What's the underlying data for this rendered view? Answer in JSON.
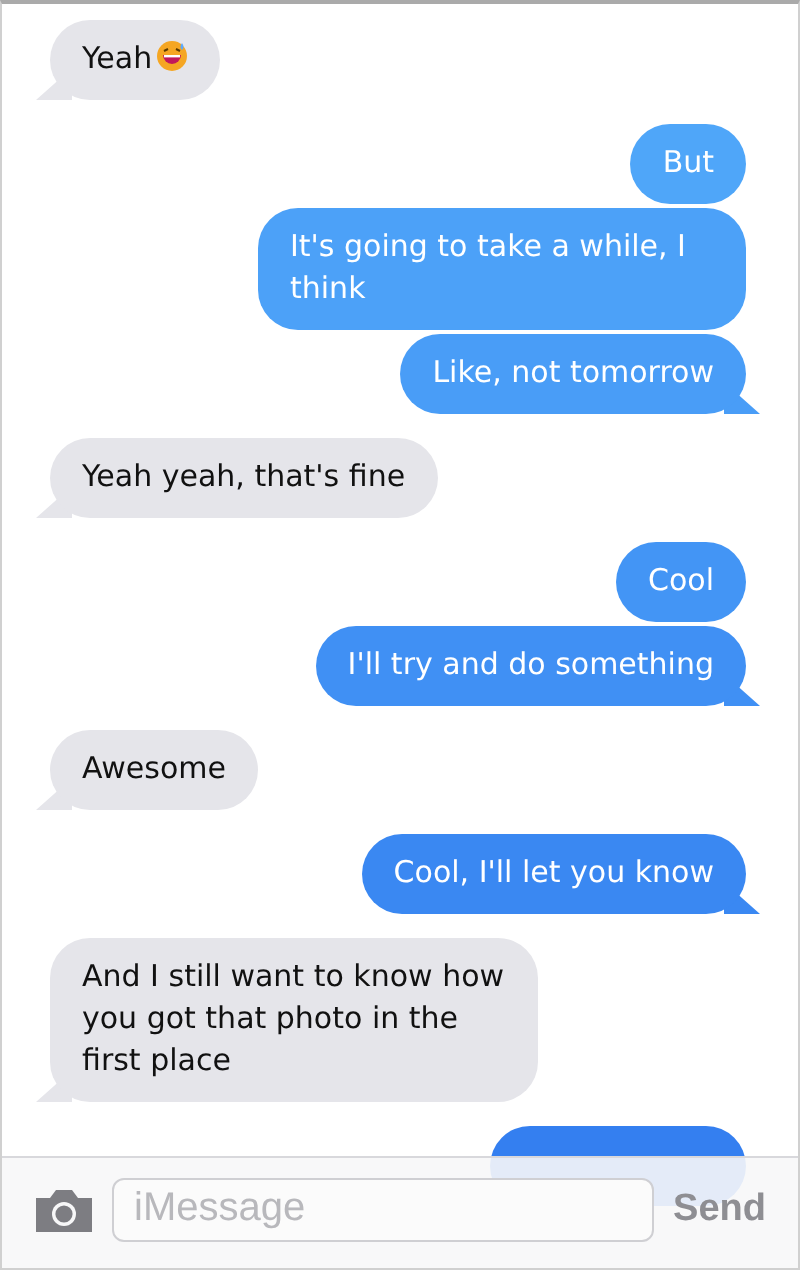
{
  "messages": [
    {
      "kind": "received",
      "text": "Yeah",
      "emoji": true
    },
    {
      "kind": "sent",
      "text": "But",
      "emoji": false
    },
    {
      "kind": "sent",
      "text": "It's going to take a while, I think",
      "emoji": false
    },
    {
      "kind": "sent",
      "text": "Like, not tomorrow",
      "emoji": false
    },
    {
      "kind": "received",
      "text": "Yeah yeah, that's fine",
      "emoji": false
    },
    {
      "kind": "sent",
      "text": "Cool",
      "emoji": false
    },
    {
      "kind": "sent",
      "text": "I'll try and do something",
      "emoji": false
    },
    {
      "kind": "received",
      "text": "Awesome",
      "emoji": false
    },
    {
      "kind": "sent",
      "text": "Cool, I'll let you know",
      "emoji": false
    },
    {
      "kind": "received",
      "text": "And I still want to know how you got that photo in the first place",
      "emoji": false
    },
    {
      "kind": "sent"
    }
  ],
  "compose": {
    "placeholder": "iMessage",
    "send_label": "Send"
  }
}
